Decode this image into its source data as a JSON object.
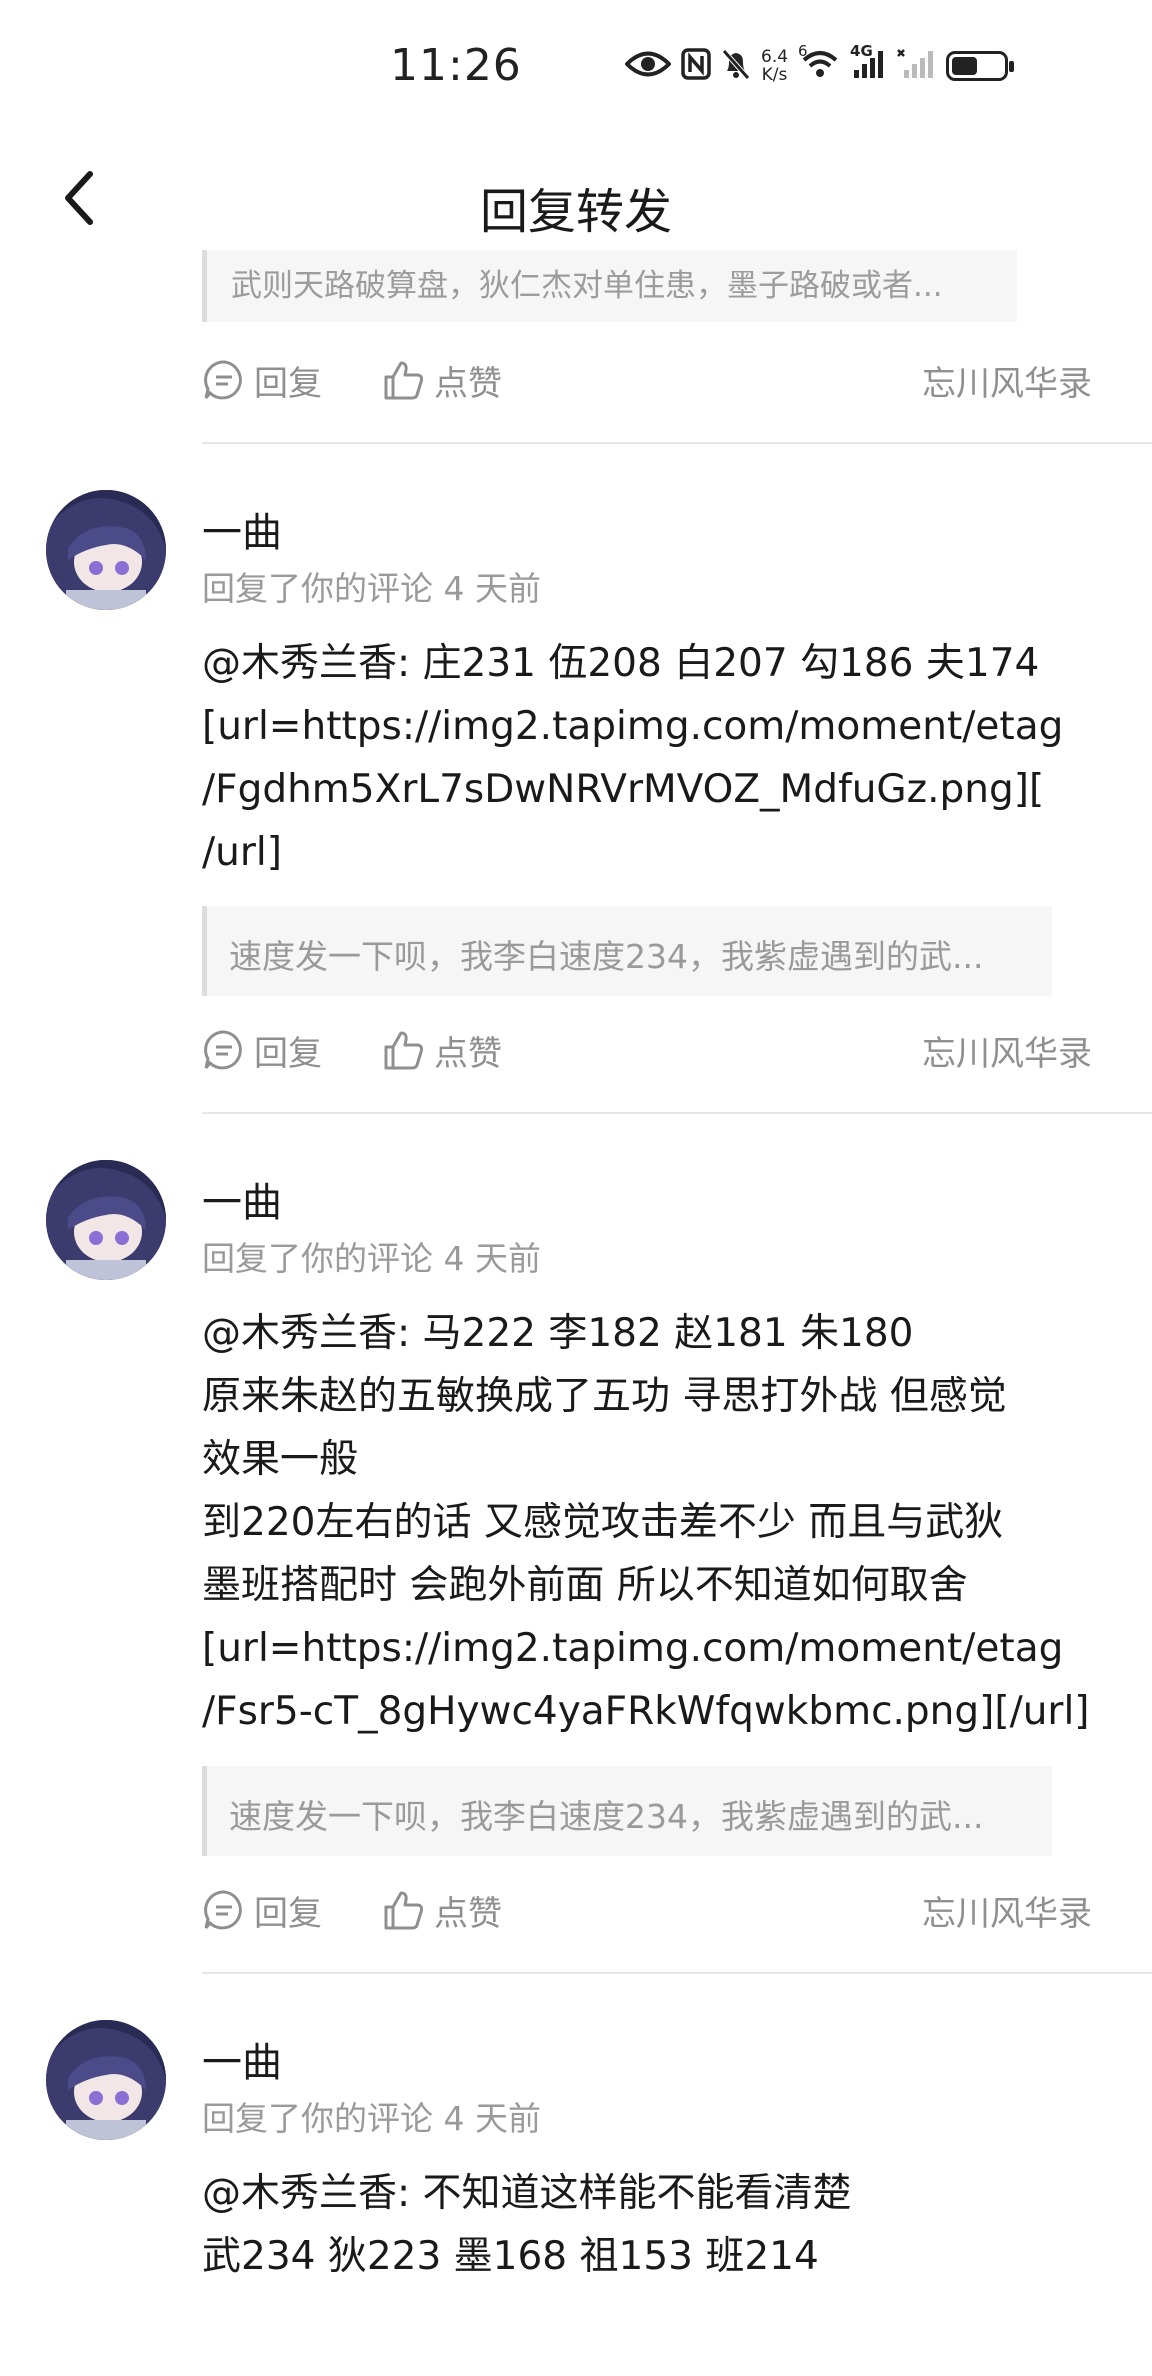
{
  "status_bar": {
    "time": "11:26",
    "net_speed_value": "6.4",
    "net_speed_unit": "K/s",
    "wifi_badge": "6",
    "network_type": "4G",
    "battery_level": 0.45
  },
  "header": {
    "title": "回复转发"
  },
  "top_partial": {
    "quote_text": "武则天路破算盘，狄仁杰对单住患，墨子路破或者..."
  },
  "actions": {
    "reply_label": "回复",
    "like_label": "点赞"
  },
  "comments": [
    {
      "username": "一曲",
      "meta": "回复了你的评论 4 天前",
      "lines": [
        "@木秀兰香: 庄231 伍208 白207 勾186 夫174",
        "[url=https://img2.tapimg.com/moment/etag",
        "/Fgdhm5XrL7sDwNRVrMVOZ_MdfuGz.png][",
        "/url]"
      ],
      "quote": "速度发一下呗，我李白速度234，我紫虚遇到的武...",
      "source": "忘川风华录"
    },
    {
      "username": "一曲",
      "meta": "回复了你的评论 4 天前",
      "lines": [
        "@木秀兰香: 马222 李182 赵181 朱180",
        "原来朱赵的五敏换成了五功 寻思打外战 但感觉",
        "效果一般",
        "到220左右的话 又感觉攻击差不少 而且与武狄",
        "墨班搭配时 会跑外前面 所以不知道如何取舍",
        "[url=https://img2.tapimg.com/moment/etag",
        "/Fsr5-cT_8gHywc4yaFRkWfqwkbmc.png][/url]"
      ],
      "quote": "速度发一下呗，我李白速度234，我紫虚遇到的武...",
      "source": "忘川风华录"
    },
    {
      "username": "一曲",
      "meta": "回复了你的评论 4 天前",
      "lines": [
        "@木秀兰香: 不知道这样能不能看清楚",
        "武234 狄223 墨168 祖153 班214"
      ]
    }
  ],
  "top_source": "忘川风华录",
  "colors": {
    "text_primary": "#1a1a1a",
    "text_secondary": "#9a9a9a",
    "quote_bg": "#f6f6f6",
    "divider": "#e6e6e6"
  }
}
